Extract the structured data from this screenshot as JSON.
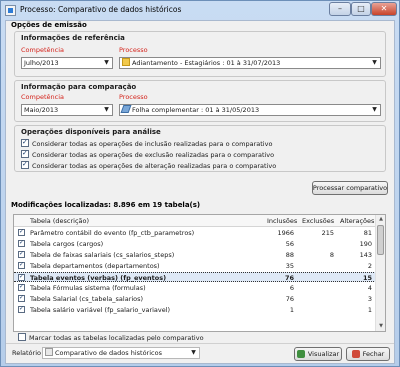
{
  "window": {
    "title": "Processo: Comparativo de dados históricos",
    "controls": {
      "minimize": "–",
      "maximize": "□",
      "close": "✕"
    }
  },
  "emissao": {
    "section_title": "Opções de emissão",
    "referencia": {
      "title": "Informações de referência",
      "competencia_label": "Competência",
      "competencia_value": "Julho/2013",
      "processo_label": "Processo",
      "processo_value": "Adiantamento - Estagiários : 01 à 31/07/2013",
      "processo_icon": "folder-icon"
    },
    "comparacao": {
      "title": "Informação para comparação",
      "competencia_label": "Competência",
      "competencia_value": "Maio/2013",
      "processo_label": "Processo",
      "processo_value": "Folha complementar : 01 à 31/05/2013",
      "processo_icon": "pencil-icon"
    },
    "operacoes": {
      "title": "Operações disponíveis para análise",
      "options": [
        {
          "label": "Considerar todas as operações de inclusão realizadas para o comparativo",
          "checked": true
        },
        {
          "label": "Considerar todas as operações de exclusão realizadas para o comparativo",
          "checked": true
        },
        {
          "label": "Considerar todas as operações de alteração realizadas para o comparativo",
          "checked": true
        }
      ]
    },
    "process_button": "Processar comparativo"
  },
  "modificacoes": {
    "section_title": "Modificações localizadas: 8.896 em 19 tabela(s)",
    "columns": [
      "Tabela (descrição)",
      "Inclusões",
      "Exclusões",
      "Alterações"
    ],
    "rows": [
      {
        "checked": true,
        "name": "Parâmetro contábil do evento (fp_ctb_parametros)",
        "inclusoes": "1966",
        "exclusoes": "215",
        "alteracoes": "81"
      },
      {
        "checked": true,
        "name": "Tabela cargos (cargos)",
        "inclusoes": "56",
        "exclusoes": "",
        "alteracoes": "190"
      },
      {
        "checked": true,
        "name": "Tabela de faixas salariais (cs_salarios_steps)",
        "inclusoes": "88",
        "exclusoes": "8",
        "alteracoes": "143"
      },
      {
        "checked": true,
        "name": "Tabela departamentos (departamentos)",
        "inclusoes": "35",
        "exclusoes": "",
        "alteracoes": "2"
      },
      {
        "checked": true,
        "name": "Tabela eventos (verbas) (fp_eventos)",
        "inclusoes": "76",
        "exclusoes": "",
        "alteracoes": "15",
        "selected": true
      },
      {
        "checked": true,
        "name": "Tabela Fórmulas sistema (formulas)",
        "inclusoes": "6",
        "exclusoes": "",
        "alteracoes": "4"
      },
      {
        "checked": true,
        "name": "Tabela Salarial (cs_tabela_salarios)",
        "inclusoes": "76",
        "exclusoes": "",
        "alteracoes": "3"
      },
      {
        "checked": true,
        "name": "Tabela salário variável (fp_salario_variavel)",
        "inclusoes": "1",
        "exclusoes": "",
        "alteracoes": "1"
      }
    ],
    "mark_all_label": "Marcar todas as tabelas localizadas pelo comparativo",
    "mark_all_checked": false
  },
  "footer": {
    "relatorio_label": "Relatório",
    "relatorio_value": "Comparativo de dados históricos",
    "visualizar_button": "Visualizar",
    "fechar_button": "Fechar"
  }
}
